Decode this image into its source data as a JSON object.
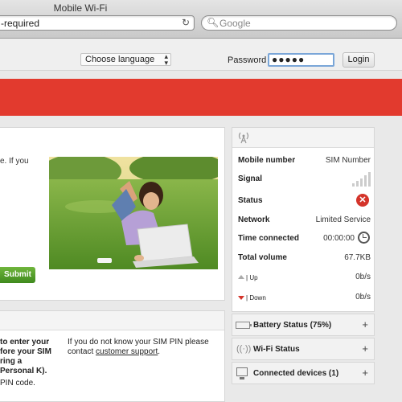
{
  "browser": {
    "title": "Mobile Wi-Fi",
    "url": "-required",
    "search_placeholder": "Google"
  },
  "header": {
    "language_select": "Choose language",
    "password_label": "Password",
    "password_value": "●●●●●",
    "login_label": "Login"
  },
  "main": {
    "intro_text": "e. If you",
    "submit_label": "Submit"
  },
  "pin_card": {
    "left_text": "to enter your fore your SIM ring a Personal K).",
    "left_text2": "PIN code.",
    "right_text_prefix": "If you do not know your SIM PIN please contact ",
    "right_link": "customer support",
    "right_text_suffix": "."
  },
  "status_panel": {
    "rows": {
      "mobile_number": {
        "label": "Mobile number",
        "value": "SIM Number"
      },
      "signal": {
        "label": "Signal"
      },
      "status": {
        "label": "Status",
        "icon": "error-icon"
      },
      "network": {
        "label": "Network",
        "value": "Limited Service"
      },
      "time_connected": {
        "label": "Time connected",
        "value": "00:00:00"
      },
      "total_volume": {
        "label": "Total volume",
        "value": "67.7KB"
      },
      "up": {
        "label": "Up",
        "value": "0b/s"
      },
      "down": {
        "label": "Down",
        "value": "0b/s"
      }
    }
  },
  "accordion": {
    "battery": "Battery Status (75%)",
    "wifi": "Wi-Fi Status",
    "devices": "Connected devices (1)"
  },
  "colors": {
    "banner": "#e23a2e",
    "submit": "#4a9624",
    "error": "#d4342a"
  }
}
